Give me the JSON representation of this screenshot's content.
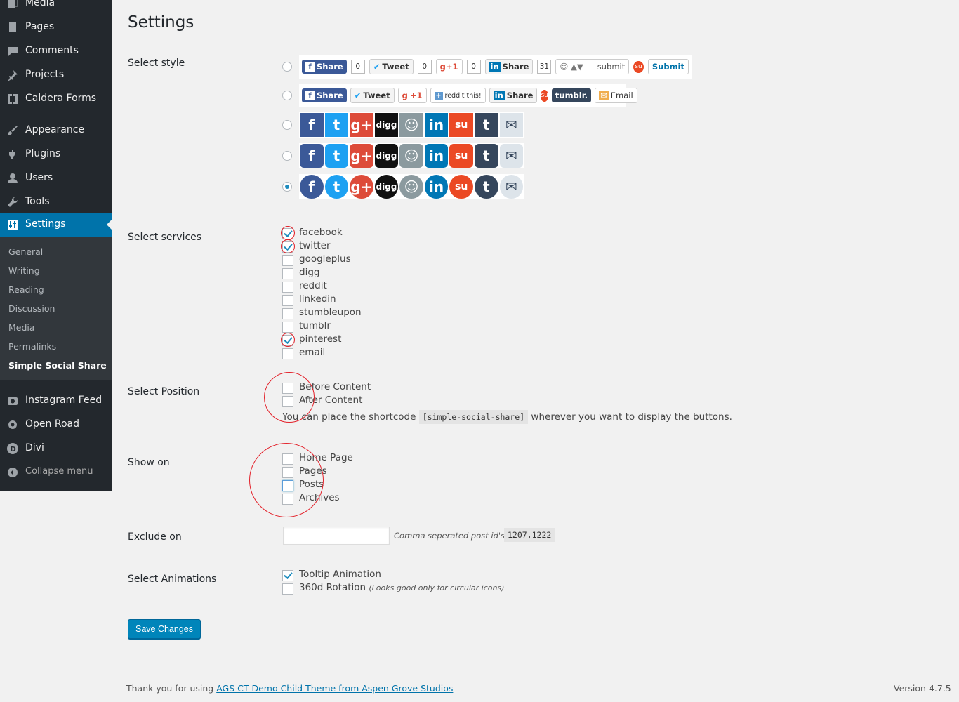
{
  "menu": {
    "items": [
      {
        "label": "Media",
        "icon": "media-icon"
      },
      {
        "label": "Pages",
        "icon": "pages-icon"
      },
      {
        "label": "Comments",
        "icon": "comments-icon"
      },
      {
        "label": "Projects",
        "icon": "projects-icon"
      },
      {
        "label": "Caldera Forms",
        "icon": "caldera-forms-icon"
      },
      {
        "label": "Appearance",
        "icon": "appearance-icon"
      },
      {
        "label": "Plugins",
        "icon": "plugins-icon"
      },
      {
        "label": "Users",
        "icon": "users-icon"
      },
      {
        "label": "Tools",
        "icon": "tools-icon"
      },
      {
        "label": "Settings",
        "icon": "settings-icon"
      },
      {
        "label": "Instagram Feed",
        "icon": "instagram-icon"
      },
      {
        "label": "Open Road",
        "icon": "gear-icon"
      },
      {
        "label": "Divi",
        "icon": "divi-icon"
      },
      {
        "label": "Collapse menu",
        "icon": "collapse-icon"
      }
    ],
    "submenu": [
      "General",
      "Writing",
      "Reading",
      "Discussion",
      "Media",
      "Permalinks",
      "Simple Social Share"
    ]
  },
  "page": {
    "title": "Settings"
  },
  "labels": {
    "style": "Select style",
    "services": "Select services",
    "position": "Select Position",
    "show_on": "Show on",
    "exclude": "Exclude on",
    "animations": "Select Animations"
  },
  "style_row1": {
    "fb": "Share",
    "fb_count": "0",
    "tw": "Tweet",
    "tw_count": "0",
    "gp": "g+1",
    "gp_count": "0",
    "li": "Share",
    "li_count": "31",
    "reddit": "submit",
    "su": "Submit"
  },
  "style_row2": {
    "fb": "Share",
    "tw": "Tweet",
    "gp": "+1",
    "reddit": "reddit this!",
    "li": "Share",
    "tumblr": "tumblr.",
    "email": "Email"
  },
  "icon_glyphs": {
    "fb": "f",
    "tw": "t",
    "gp": "g+",
    "dg": "digg",
    "rd": "☺",
    "li": "in",
    "su": "su",
    "tb": "t",
    "em": "✉"
  },
  "style_selected": 5,
  "services": [
    {
      "label": "facebook",
      "checked": true
    },
    {
      "label": "twitter",
      "checked": true
    },
    {
      "label": "googleplus",
      "checked": false
    },
    {
      "label": "digg",
      "checked": false
    },
    {
      "label": "reddit",
      "checked": false
    },
    {
      "label": "linkedin",
      "checked": false
    },
    {
      "label": "stumbleupon",
      "checked": false
    },
    {
      "label": "tumblr",
      "checked": false
    },
    {
      "label": "pinterest",
      "checked": true
    },
    {
      "label": "email",
      "checked": false
    }
  ],
  "positions": [
    {
      "label": "Before Content",
      "checked": false
    },
    {
      "label": "After Content",
      "checked": false
    }
  ],
  "shortcode": {
    "before": "You can place the shortcode",
    "code": "[simple-social-share]",
    "after": "wherever you want to display the buttons."
  },
  "show_on": [
    {
      "label": "Home Page",
      "checked": false
    },
    {
      "label": "Pages",
      "checked": false
    },
    {
      "label": "Posts",
      "checked": false
    },
    {
      "label": "Archives",
      "checked": false
    }
  ],
  "exclude": {
    "value": "",
    "desc": "Comma seperated post id's Eg:",
    "example": "1207,1222"
  },
  "animations": [
    {
      "label": "Tooltip Animation",
      "checked": true,
      "note": ""
    },
    {
      "label": "360d Rotation",
      "checked": false,
      "note": "(Looks good only for circular icons)"
    }
  ],
  "save": "Save Changes",
  "footer": {
    "thanks": "Thank you for using",
    "link": "AGS CT Demo Child Theme from Aspen Grove Studios",
    "version": "Version 4.7.5"
  }
}
